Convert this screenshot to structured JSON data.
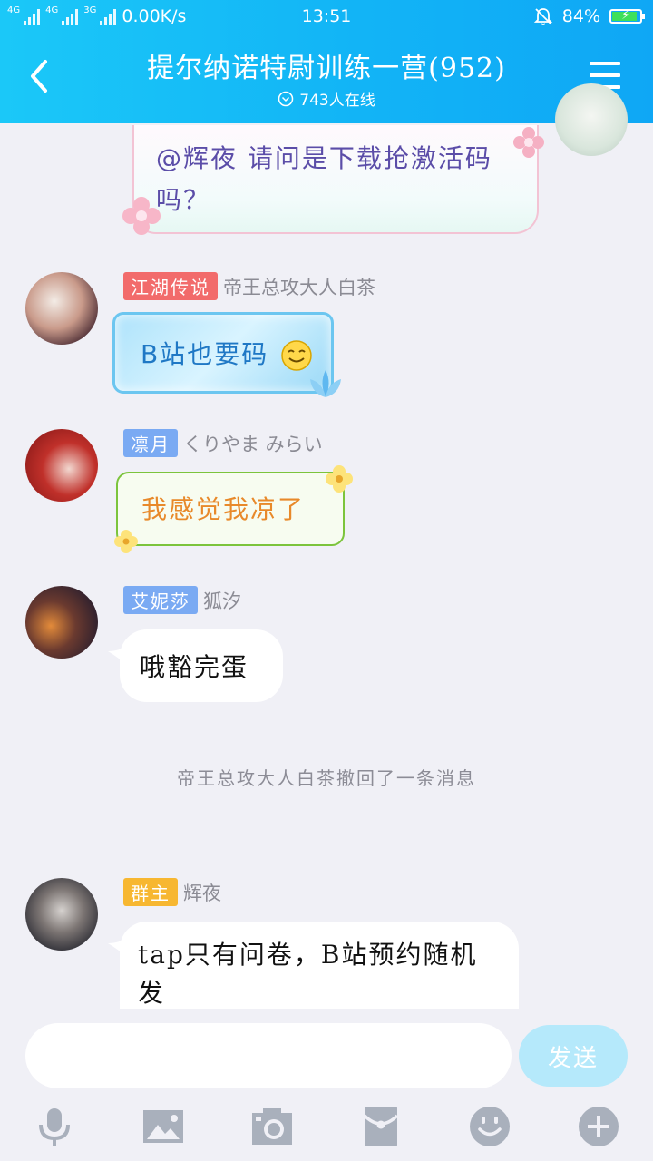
{
  "status_bar": {
    "net1": "4G",
    "net2": "4G",
    "net3": "3G",
    "speed": "0.00K/s",
    "time": "13:51",
    "battery": "84%",
    "battery_level": 0.84
  },
  "header": {
    "title": "提尔纳诺特尉训练一营(952)",
    "online": "743人在线"
  },
  "messages": [
    {
      "text": "@辉夜 请问是下载抢激活码吗？"
    },
    {
      "badge": "江湖传说",
      "badge_color": "#f26b6b",
      "name": "帝王总攻大人白茶",
      "text": "B站也要码"
    },
    {
      "badge": "凛月",
      "badge_color": "#7aaaf3",
      "name": "くりやま みらい",
      "text": "我感觉我凉了"
    },
    {
      "badge": "艾妮莎",
      "badge_color": "#7aaaf3",
      "name": "狐汐",
      "text": "哦豁完蛋"
    },
    {
      "badge": "群主",
      "badge_color": "#f7b731",
      "name": "辉夜",
      "text": "tap只有问卷，B站预约随机发"
    }
  ],
  "system_message": "帝王总攻大人白茶撤回了一条消息",
  "composer": {
    "placeholder": "",
    "send_label": "发送"
  },
  "toolbar": {
    "icons": [
      "microphone-icon",
      "image-icon",
      "camera-icon",
      "red-packet-icon",
      "emoji-icon",
      "plus-icon"
    ]
  },
  "colors": {
    "header_start": "#1bc8f8",
    "header_end": "#0fa7f5",
    "send_button": "#b5e9fb",
    "toolbar_icon": "#a9b0bc"
  }
}
